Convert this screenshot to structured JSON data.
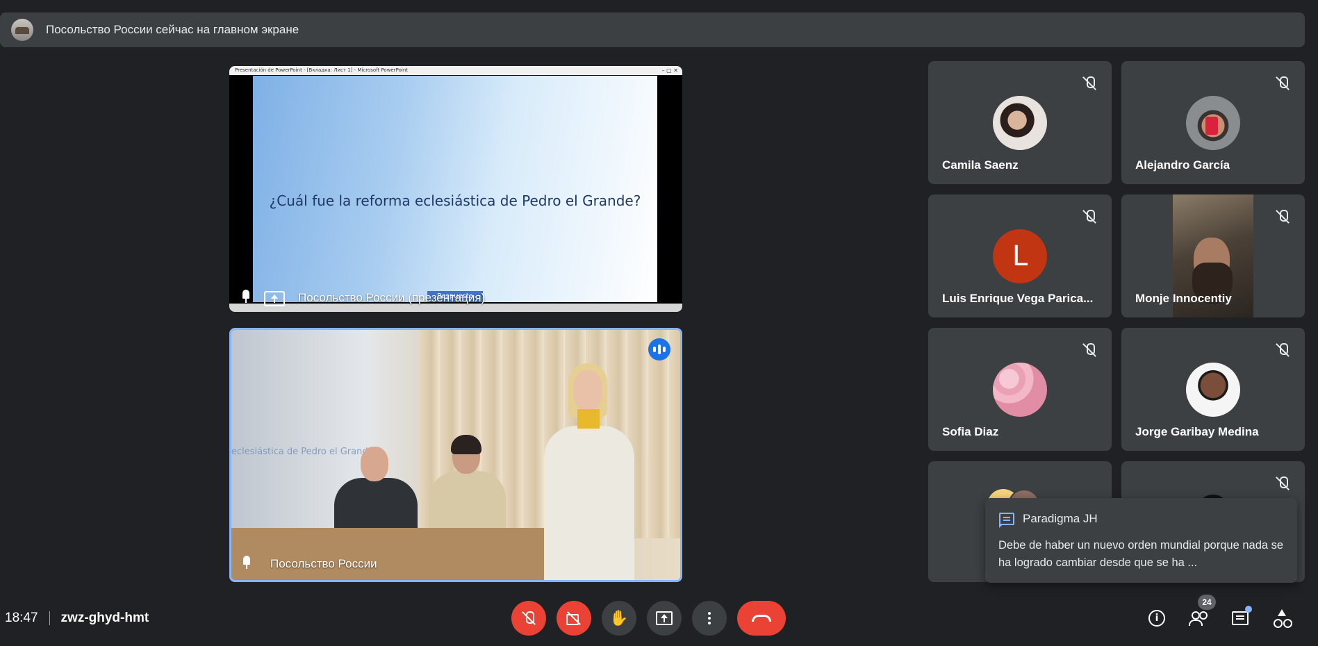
{
  "banner": {
    "text": "Посольство России сейчас на главном экране"
  },
  "presentation": {
    "window_title": "Presentación de PowerPoint - [Вкладка: Лист 1] - Microsoft PowerPoint",
    "window_controls": "–  ▢  ✕",
    "slide_question": "¿Cuál fue la reforma eclesiástica de Pedro el Grande?",
    "slide_button": "Respuesta",
    "tile_label": "Посольство России (презентация)"
  },
  "camera": {
    "tile_label": "Посольство России",
    "wall_text": "eclesiástica de Pedro el Grande"
  },
  "participants": [
    {
      "name": "Camila Saenz"
    },
    {
      "name": "Alejandro García"
    },
    {
      "name": "Luis Enrique Vega Parica...",
      "initial": "L"
    },
    {
      "name": "Monje Innocentiy"
    },
    {
      "name": "Sofia Diaz"
    },
    {
      "name": "Jorge Garibay Medina"
    }
  ],
  "chat_toast": {
    "sender": "Paradigma JH",
    "message": "Debe de haber un nuevo orden mundial porque nada se ha logrado cambiar desde que se ha ..."
  },
  "meeting": {
    "time": "18:47",
    "code": "zwz-ghyd-hmt",
    "participant_count": "24"
  },
  "colors": {
    "background": "#202124",
    "tile": "#3c4043",
    "accent": "#8ab4f8",
    "danger": "#ea4335",
    "speaking": "#1a73e8"
  }
}
